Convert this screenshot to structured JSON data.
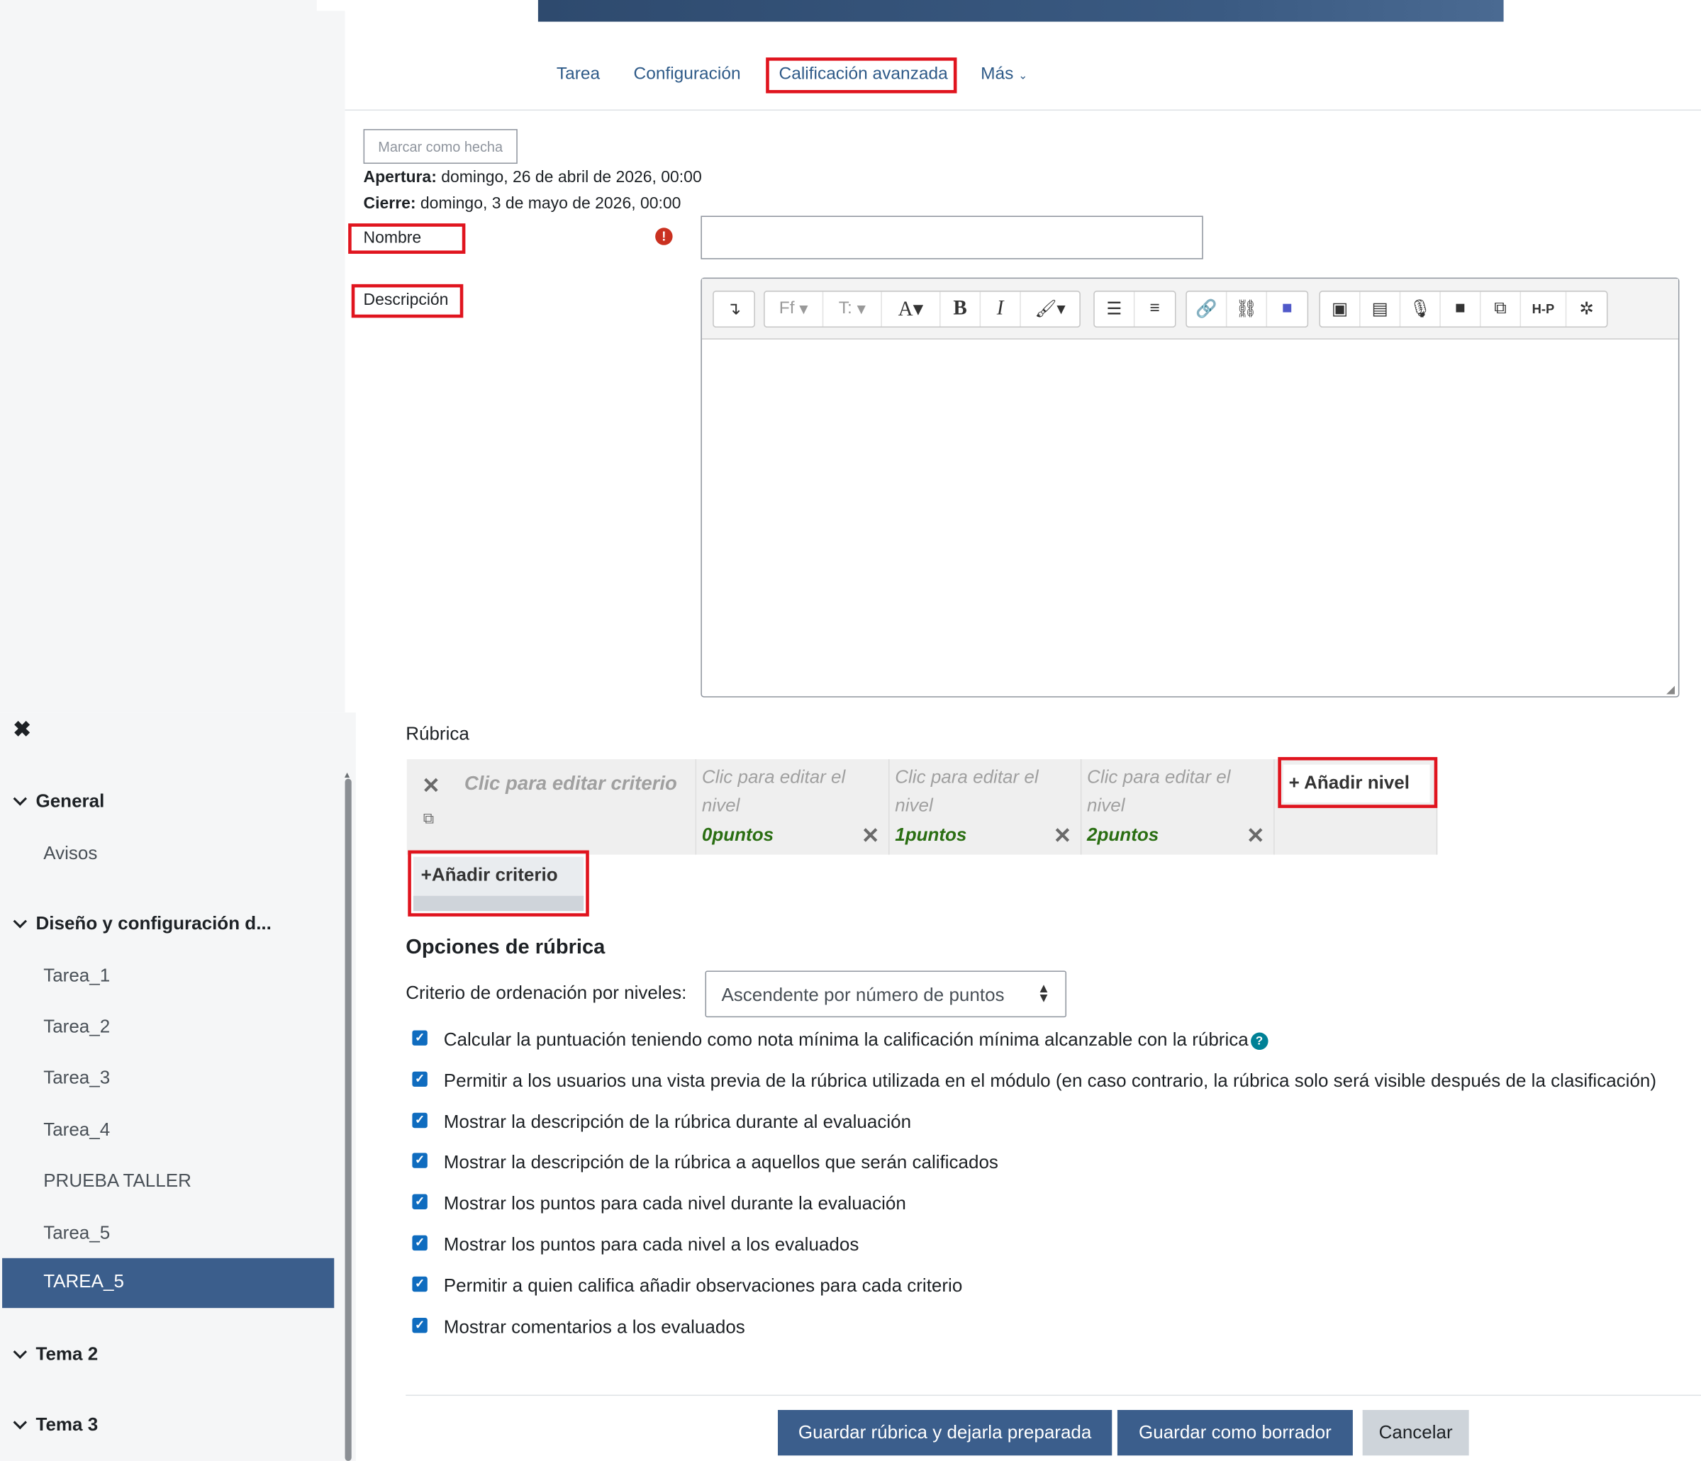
{
  "nav": {
    "tabs": [
      "Tarea",
      "Configuración",
      "Calificación avanzada",
      "Más"
    ],
    "active_tab": "Calificación avanzada"
  },
  "activity": {
    "mark_done_label": "Marcar como hecha",
    "opening_label": "Apertura:",
    "opening_value": "domingo, 26 de abril de 2026, 00:00",
    "closing_label": "Cierre:",
    "closing_value": "domingo, 3 de mayo de 2026, 00:00"
  },
  "form": {
    "name_label": "Nombre",
    "name_value": "",
    "description_label": "Descripción",
    "required_icon": "exclamation-circle-icon"
  },
  "editor": {
    "toolbar_buttons": [
      "collapse-icon",
      "font-family-icon",
      "font-size-icon",
      "font-color-icon",
      "bold-icon",
      "italic-icon",
      "brush-icon",
      "bullet-list-icon",
      "numbered-list-icon",
      "link-icon",
      "unlink-icon",
      "teams-icon",
      "image-icon",
      "media-icon",
      "microphone-icon",
      "video-icon",
      "copy-icon",
      "h5p-icon",
      "gear-icon"
    ],
    "font_family_short": "Ff",
    "font_size_short": "T:",
    "bold_glyph": "B",
    "italic_glyph": "I",
    "h5p_label": "H-P"
  },
  "rubric": {
    "title": "Rúbrica",
    "criterion_placeholder": "Clic para editar criterio",
    "level_placeholder": "Clic para editar el nivel",
    "levels": [
      {
        "text": "Clic para editar el nivel",
        "points": "0puntos"
      },
      {
        "text": "Clic para editar el nivel",
        "points": "1puntos"
      },
      {
        "text": "Clic para editar el nivel",
        "points": "2puntos"
      }
    ],
    "add_level_label": "Añadir nivel",
    "add_criterion_label": "Añadir criterio"
  },
  "options": {
    "heading": "Opciones de rúbrica",
    "sort_label": "Criterio de ordenación por niveles:",
    "sort_value": "Ascendente por número de puntos",
    "checkboxes": [
      {
        "label": "Calcular la puntuación teniendo como nota mínima la calificación mínima alcanzable con la rúbrica",
        "checked": true
      },
      {
        "label": "Permitir a los usuarios una vista previa de la rúbrica utilizada en el módulo (en caso contrario, la rúbrica solo será visible después de la clasificación)",
        "checked": true
      },
      {
        "label": "Mostrar la descripción de la rúbrica durante al evaluación",
        "checked": true
      },
      {
        "label": "Mostrar la descripción de la rúbrica a aquellos que serán calificados",
        "checked": true
      },
      {
        "label": "Mostrar los puntos para cada nivel durante la evaluación",
        "checked": true
      },
      {
        "label": "Mostrar los puntos para cada nivel a los evaluados",
        "checked": true
      },
      {
        "label": "Permitir a quien califica añadir observaciones para cada criterio",
        "checked": true
      },
      {
        "label": "Mostrar comentarios a los evaluados",
        "checked": true
      }
    ]
  },
  "footer": {
    "save_ready_label": "Guardar rúbrica y dejarla preparada",
    "save_draft_label": "Guardar como borrador",
    "cancel_label": "Cancelar"
  },
  "course_index": {
    "sections": [
      {
        "title": "General",
        "items": [
          "Avisos"
        ]
      },
      {
        "title": "Diseño y configuración d...",
        "items": [
          "Tarea_1",
          "Tarea_2",
          "Tarea_3",
          "Tarea_4",
          "PRUEBA TALLER",
          "Tarea_5",
          "TAREA_5"
        ]
      },
      {
        "title": "Tema 2",
        "items": []
      },
      {
        "title": "Tema 3",
        "items": []
      }
    ],
    "active_item": "TAREA_5"
  },
  "colors": {
    "accent": "#3b5e8c",
    "highlight_box": "#e0141e",
    "points": "#2a6e12",
    "checkbox": "#0f6cbf"
  }
}
